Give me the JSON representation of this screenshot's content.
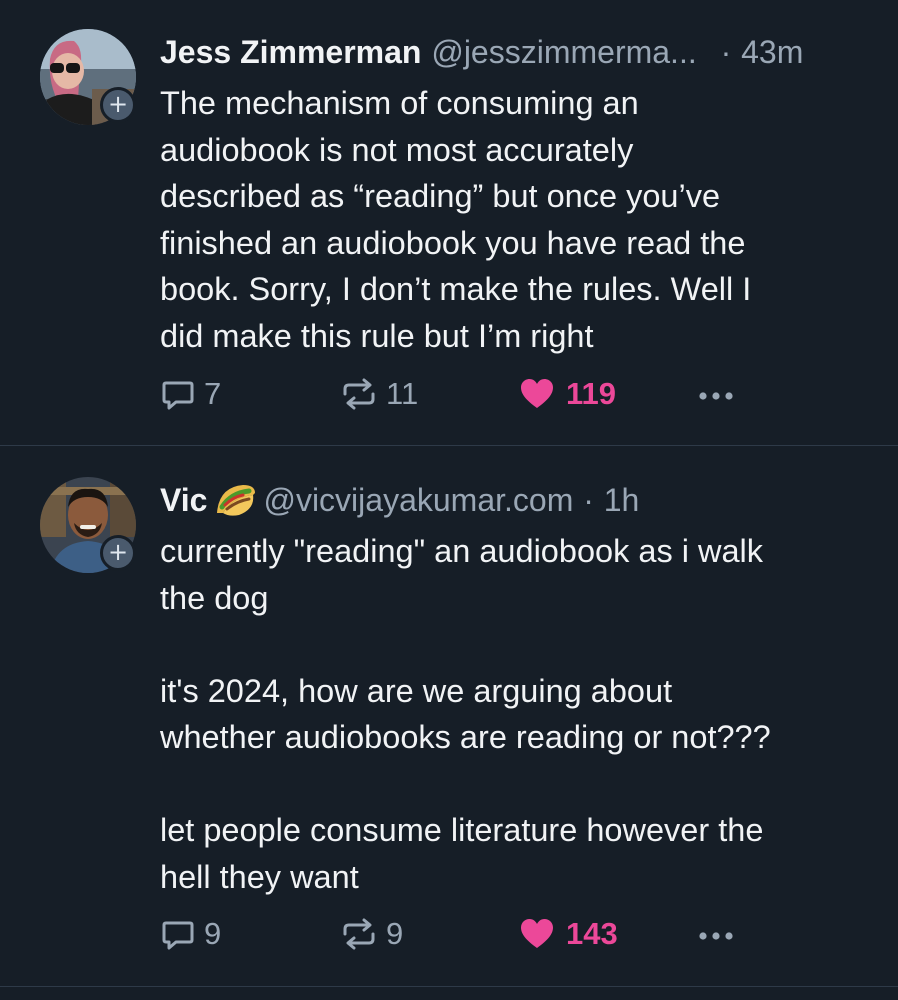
{
  "posts": [
    {
      "author_name": "Jess Zimmerman",
      "author_handle": "@jesszimmerma...",
      "separator": "·",
      "time": "43m",
      "text": "The mechanism of consuming an\naudiobook is not most accurately\ndescribed as “reading” but once you’ve\nfinished an audiobook you have read the\nbook. Sorry, I don’t make the rules. Well I\ndid make this rule but I’m right",
      "reply_count": "7",
      "repost_count": "11",
      "like_count": "119",
      "follow_badge": "+"
    },
    {
      "author_name": "Vic",
      "author_emoji": "taco-emoji",
      "author_handle": "@vicvijayakumar.com",
      "separator": "·",
      "time": "1h",
      "text": "currently \"reading\" an audiobook as i walk\nthe dog\n\nit's 2024, how are we arguing about\nwhether audiobooks are reading or not???\n\nlet people consume literature however the\nhell they want",
      "reply_count": "9",
      "repost_count": "9",
      "like_count": "143",
      "follow_badge": "+"
    }
  ],
  "colors": {
    "background": "#161e27",
    "text": "#f1f3f5",
    "muted": "#9aa7b5",
    "like": "#ec4899",
    "divider": "#2e3a48"
  },
  "icons": [
    "reply-icon",
    "repost-icon",
    "heart-icon",
    "more-icon"
  ]
}
